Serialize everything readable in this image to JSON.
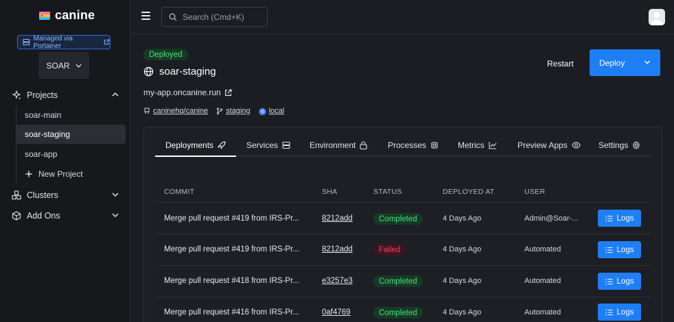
{
  "brand": {
    "name": "canine"
  },
  "sidebar": {
    "portainer_badge": "Managed via Portainer",
    "project_select": "SOAR",
    "sections": {
      "projects": "Projects",
      "clusters": "Clusters",
      "addons": "Add Ons"
    },
    "items": [
      {
        "label": "soar-main",
        "active": false
      },
      {
        "label": "soar-staging",
        "active": true
      },
      {
        "label": "soar-app",
        "active": false
      }
    ],
    "new_project": "New Project"
  },
  "topbar": {
    "search_placeholder": "Search (Cmd+K)"
  },
  "app": {
    "status_badge": "Deployed",
    "title": "soar-staging",
    "url": "my-app.oncanine.run",
    "repo": "caninehq/canine",
    "branch": "staging",
    "cluster": "local",
    "restart_label": "Restart",
    "deploy_label": "Deploy"
  },
  "tabs": [
    {
      "label": "Deployments",
      "icon": "rocket-icon",
      "active": true
    },
    {
      "label": "Services",
      "icon": "server-icon",
      "active": false
    },
    {
      "label": "Environment",
      "icon": "lock-icon",
      "active": false
    },
    {
      "label": "Processes",
      "icon": "cpu-icon",
      "active": false
    },
    {
      "label": "Metrics",
      "icon": "chart-icon",
      "active": false
    },
    {
      "label": "Preview Apps",
      "icon": "eye-icon",
      "active": false
    },
    {
      "label": "Settings",
      "icon": "gear-icon",
      "active": false
    }
  ],
  "table": {
    "headers": [
      "COMMIT",
      "SHA",
      "STATUS",
      "DEPLOYED AT",
      "USER"
    ],
    "rows": [
      {
        "commit": "Merge pull request #419 from IRS-Pr...",
        "sha": "8212add",
        "status": "Completed",
        "deployed_at": "4 Days Ago",
        "user": "Admin@Soar-...",
        "logs": "Logs"
      },
      {
        "commit": "Merge pull request #419 from IRS-Pr...",
        "sha": "8212add",
        "status": "Failed",
        "deployed_at": "4 Days Ago",
        "user": "Automated",
        "logs": "Logs"
      },
      {
        "commit": "Merge pull request #418 from IRS-Pr...",
        "sha": "e3257e3",
        "status": "Completed",
        "deployed_at": "4 Days Ago",
        "user": "Automated",
        "logs": "Logs"
      },
      {
        "commit": "Merge pull request #416 from IRS-Pr...",
        "sha": "0af4769",
        "status": "Completed",
        "deployed_at": "4 Days Ago",
        "user": "Automated",
        "logs": "Logs"
      }
    ]
  },
  "colors": {
    "accent": "#1e7ef4",
    "success": "#4ade80",
    "danger": "#f43f5e",
    "background": "#1b1d22"
  }
}
